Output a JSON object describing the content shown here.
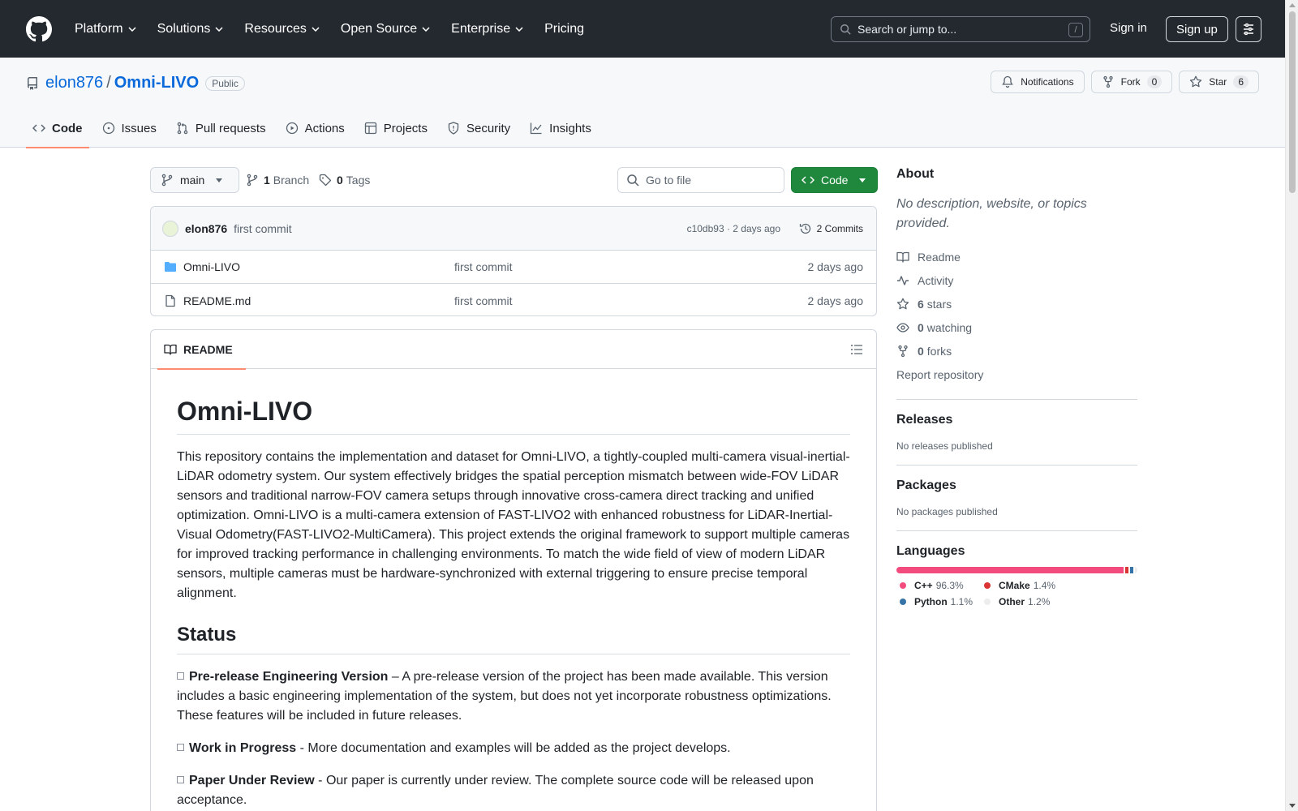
{
  "header": {
    "nav": [
      "Platform",
      "Solutions",
      "Resources",
      "Open Source",
      "Enterprise",
      "Pricing"
    ],
    "search_placeholder": "Search or jump to...",
    "search_shortcut": "/",
    "signin": "Sign in",
    "signup": "Sign up"
  },
  "repo": {
    "owner": "elon876",
    "separator": "/",
    "name": "Omni-LIVO",
    "visibility": "Public",
    "notifications": "Notifications",
    "fork_label": "Fork",
    "fork_count": "0",
    "star_label": "Star",
    "star_count": "6",
    "tabs": [
      "Code",
      "Issues",
      "Pull requests",
      "Actions",
      "Projects",
      "Security",
      "Insights"
    ]
  },
  "toolbar": {
    "branch": "main",
    "branch_count": "1",
    "branch_label": "Branch",
    "tag_count": "0",
    "tag_label": "Tags",
    "goto_file": "Go to file",
    "code_button": "Code"
  },
  "commit": {
    "author": "elon876",
    "message": "first commit",
    "sha_date": "c10db93 · 2 days ago",
    "commits": "2 Commits"
  },
  "files": [
    {
      "name": "Omni-LIVO",
      "type": "folder",
      "message": "first commit",
      "date": "2 days ago"
    },
    {
      "name": "README.md",
      "type": "file",
      "message": "first commit",
      "date": "2 days ago"
    }
  ],
  "readme": {
    "tab": "README",
    "title": "Omni-LIVO",
    "intro": "This repository contains the implementation and dataset for Omni-LIVO, a tightly-coupled multi-camera visual-inertial-LiDAR odometry system. Our system effectively bridges the spatial perception mismatch between wide-FOV LiDAR sensors and traditional narrow-FOV camera setups through innovative cross-camera direct tracking and unified optimization. Omni-LIVO is a multi-camera extension of FAST-LIVO2 with enhanced robustness for LiDAR-Inertial-Visual Odometry(FAST-LIVO2-MultiCamera). This project extends the original framework to support multiple cameras for improved tracking performance in challenging environments. To match the wide field of view of modern LiDAR sensors, multiple cameras must be hardware-synchronized with external triggering to ensure precise temporal alignment.",
    "status_heading": "Status",
    "status_items": [
      {
        "title": "Pre-release Engineering Version",
        "text": " – A pre-release version of the project has been made available. This version includes a basic engineering implementation of the system, but does not yet incorporate robustness optimizations. These features will be included in future releases."
      },
      {
        "title": "Work in Progress",
        "text": " - More documentation and examples will be added as the project develops."
      },
      {
        "title": "Paper Under Review",
        "text": " - Our paper is currently under review. The complete source code will be released upon acceptance."
      }
    ]
  },
  "sidebar": {
    "about_heading": "About",
    "about_desc": "No description, website, or topics provided.",
    "readme": "Readme",
    "activity": "Activity",
    "stars_count": "6",
    "stars_label": "stars",
    "watching_count": "0",
    "watching_label": "watching",
    "forks_count": "0",
    "forks_label": "forks",
    "report": "Report repository",
    "releases_heading": "Releases",
    "releases_text": "No releases published",
    "packages_heading": "Packages",
    "packages_text": "No packages published",
    "languages_heading": "Languages",
    "languages": [
      {
        "name": "C++",
        "percent": "96.3%",
        "value": 96.3,
        "color": "#f34b7d"
      },
      {
        "name": "CMake",
        "percent": "1.4%",
        "value": 1.4,
        "color": "#da3434"
      },
      {
        "name": "Python",
        "percent": "1.1%",
        "value": 1.1,
        "color": "#3572a5"
      },
      {
        "name": "Other",
        "percent": "1.2%",
        "value": 1.2,
        "color": "#ededed"
      }
    ]
  }
}
